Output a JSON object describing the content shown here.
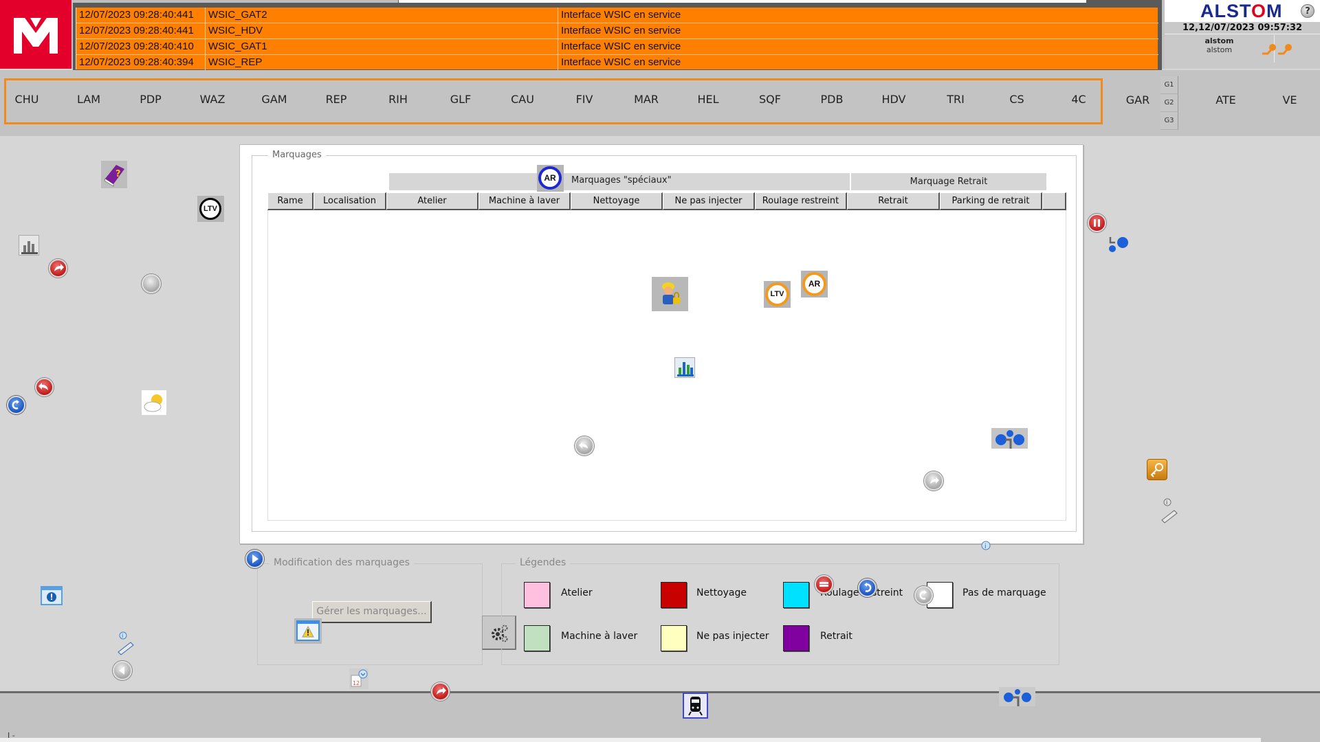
{
  "header": {
    "logo": "M",
    "alarms": [
      {
        "time": "12/07/2023 09:28:40:441",
        "source": "WSIC_GAT2",
        "message": "Interface WSIC en service"
      },
      {
        "time": "12/07/2023 09:28:40:441",
        "source": "WSIC_HDV",
        "message": "Interface WSIC en service"
      },
      {
        "time": "12/07/2023 09:28:40:410",
        "source": "WSIC_GAT1",
        "message": "Interface WSIC en service"
      },
      {
        "time": "12/07/2023 09:28:40:394",
        "source": "WSIC_REP",
        "message": "Interface WSIC en service"
      }
    ],
    "alarm_color": "#ff8000",
    "brand_pre": "ALST",
    "brand_o": "O",
    "brand_post": "M",
    "help": "?",
    "clock": "12,12/07/2023 09:57:32",
    "user": {
      "name": "alstom",
      "role": "alstom"
    }
  },
  "stations": {
    "line": [
      "CHU",
      "LAM",
      "PDP",
      "WAZ",
      "GAM",
      "REP",
      "RIH",
      "GLF",
      "CAU",
      "FIV",
      "MAR",
      "HEL",
      "SQF",
      "PDB",
      "HDV",
      "TRI",
      "CS",
      "4C"
    ],
    "extra": [
      "GAR",
      "ATE",
      "VE"
    ],
    "garage_sub": [
      "G1",
      "G2",
      "G3"
    ],
    "highlight_color": "#f08a1c"
  },
  "marquages": {
    "title": "Marquages",
    "group_special": "Marquages \"spéciaux\"",
    "group_retrait": "Marquage Retrait",
    "columns": [
      "Rame",
      "Localisation",
      "Atelier",
      "Machine à laver",
      "Nettoyage",
      "Ne pas injecter",
      "Roulage restreint",
      "Retrait",
      "Parking de retrait",
      ""
    ],
    "rows": []
  },
  "modification": {
    "title": "Modification des marquages",
    "manage_button": "Gérer les marquages..."
  },
  "legend": {
    "title": "Légendes",
    "items": [
      {
        "label": "Atelier",
        "color": "#ffc0e0"
      },
      {
        "label": "Nettoyage",
        "color": "#c80000"
      },
      {
        "label": "Roulage restreint",
        "color": "#00e0ff"
      },
      {
        "label": "Pas de marquage",
        "color": "#ffffff"
      },
      {
        "label": "Machine à laver",
        "color": "#c0e0c0"
      },
      {
        "label": "Ne pas injecter",
        "color": "#ffffc0"
      },
      {
        "label": "Retrait",
        "color": "#8000a0"
      }
    ]
  },
  "icon_badges": {
    "ltv": "LTV",
    "ar": "AR"
  },
  "bottom": {
    "cursor_text": "I -"
  }
}
